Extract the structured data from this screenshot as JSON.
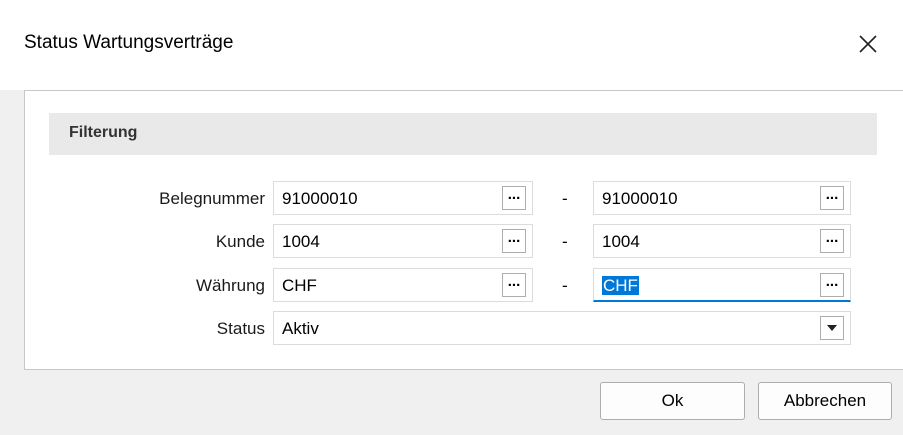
{
  "window": {
    "title": "Status Wartungsverträge",
    "close_icon": "close-icon"
  },
  "group": {
    "title": "Filterung"
  },
  "rows": {
    "belegnummer": {
      "label": "Belegnummer",
      "from": "91000010",
      "to": "91000010"
    },
    "kunde": {
      "label": "Kunde",
      "from": "1004",
      "to": "1004"
    },
    "waehrung": {
      "label": "Währung",
      "from": "CHF",
      "to": "CHF"
    },
    "status": {
      "label": "Status",
      "value": "Aktiv"
    }
  },
  "separator": "-",
  "lookup_label": "...",
  "buttons": {
    "ok": "Ok",
    "cancel": "Abbrechen"
  },
  "colors": {
    "accent": "#0078d7"
  }
}
